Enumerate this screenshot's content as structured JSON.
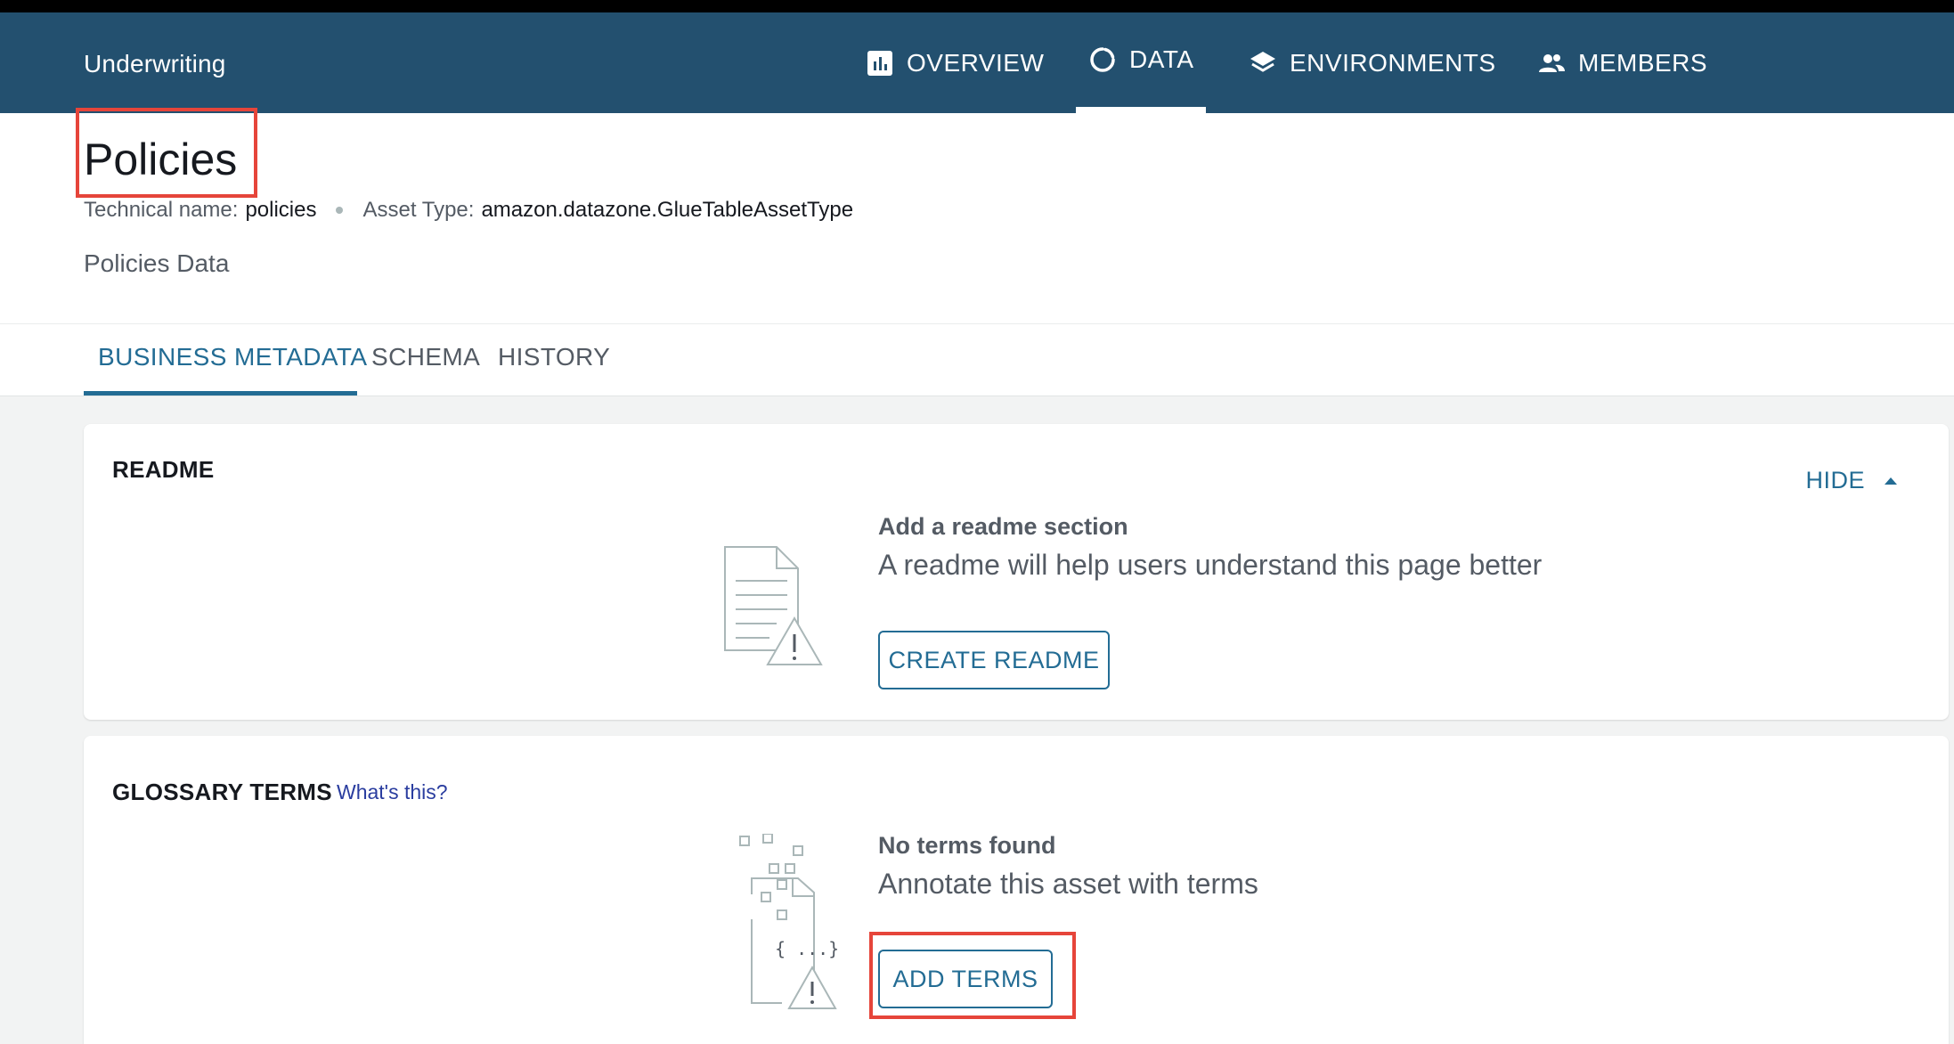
{
  "header": {
    "brand": "Underwriting",
    "nav": [
      {
        "label": "OVERVIEW",
        "icon": "bar-chart-icon"
      },
      {
        "label": "DATA",
        "icon": "circle-refresh-icon",
        "active": true
      },
      {
        "label": "ENVIRONMENTS",
        "icon": "layers-icon"
      },
      {
        "label": "MEMBERS",
        "icon": "people-icon"
      }
    ]
  },
  "asset": {
    "title": "Policies",
    "technical_name_label": "Technical name:",
    "technical_name": "policies",
    "asset_type_label": "Asset Type:",
    "asset_type": "amazon.datazone.GlueTableAssetType",
    "description": "Policies Data"
  },
  "tabs": [
    {
      "label": "BUSINESS METADATA",
      "active": true
    },
    {
      "label": "SCHEMA"
    },
    {
      "label": "HISTORY"
    }
  ],
  "readme": {
    "title": "README",
    "hide_label": "HIDE",
    "empty_heading": "Add a readme section",
    "empty_sub": "A readme will help users understand this page better",
    "button": "CREATE README"
  },
  "glossary": {
    "title": "GLOSSARY TERMS",
    "help_link": "What's this?",
    "empty_heading": "No terms found",
    "empty_sub": "Annotate this asset with terms",
    "button": "ADD TERMS"
  },
  "colors": {
    "header_bg": "#23506f",
    "accent": "#236c94",
    "highlight": "#e6453a"
  }
}
